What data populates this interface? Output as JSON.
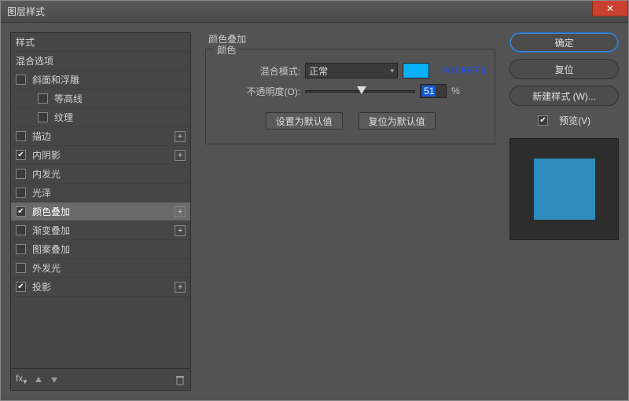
{
  "window": {
    "title": "图层样式"
  },
  "left": {
    "styles_label": "样式",
    "blend_options_label": "混合选项",
    "items": [
      {
        "label": "斜面和浮雕",
        "checked": false,
        "has_add": false
      },
      {
        "label": "等高线",
        "checked": false,
        "sub": true
      },
      {
        "label": "纹理",
        "checked": false,
        "sub": true
      },
      {
        "label": "描边",
        "checked": false,
        "has_add": true
      },
      {
        "label": "内阴影",
        "checked": true,
        "has_add": true
      },
      {
        "label": "内发光",
        "checked": false
      },
      {
        "label": "光泽",
        "checked": false
      },
      {
        "label": "颜色叠加",
        "checked": true,
        "has_add": true,
        "selected": true
      },
      {
        "label": "渐变叠加",
        "checked": false,
        "has_add": true
      },
      {
        "label": "图案叠加",
        "checked": false
      },
      {
        "label": "外发光",
        "checked": false
      },
      {
        "label": "投影",
        "checked": true,
        "has_add": true
      }
    ],
    "fx_label": "fx"
  },
  "center": {
    "section_title": "颜色叠加",
    "fieldset_legend": "颜色",
    "blend_mode_label": "混合模式:",
    "blend_mode_value": "正常",
    "color_hex": "#07AFF5",
    "opacity_label": "不透明度(O):",
    "opacity_value": "51",
    "percent": "%",
    "set_default": "设置为默认值",
    "reset_default": "复位为默认值"
  },
  "right": {
    "ok": "确定",
    "reset": "复位",
    "new_style": "新建样式 (W)...",
    "preview_label": "预览(V)",
    "preview_checked": true
  }
}
